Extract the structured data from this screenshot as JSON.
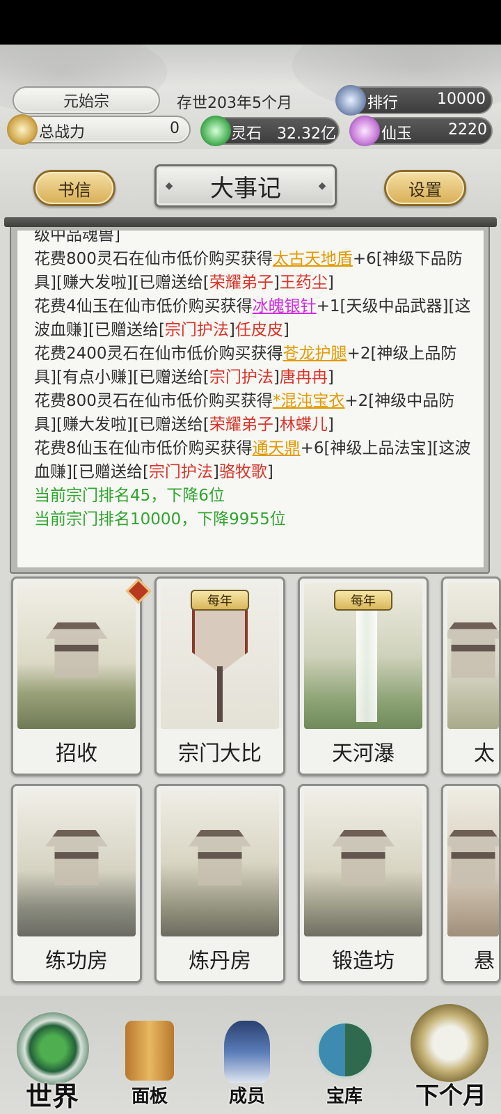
{
  "header": {
    "sect_name": "元始宗",
    "age": "存世203年5个月",
    "rank_label": "排行",
    "rank_value": "10000",
    "power_label": "总战力",
    "power_value": "0",
    "spirit_stone_label": "灵石",
    "spirit_stone_value": "32.32亿",
    "jade_label": "仙玉",
    "jade_value": "2220"
  },
  "tabs": {
    "left_button": "书信",
    "title": "大事记",
    "right_button": "设置"
  },
  "log": {
    "lines": [
      {
        "segments": [
          {
            "t": "级中品魂兽]",
            "c": ""
          }
        ]
      },
      {
        "segments": [
          {
            "t": "花费800灵石在仙市低价购买获得",
            "c": ""
          },
          {
            "t": "太古天地盾",
            "c": "gold"
          },
          {
            "t": "+6[神级下品防具][赚大发啦][已赠送给[",
            "c": ""
          },
          {
            "t": "荣耀弟子",
            "c": "red"
          },
          {
            "t": "]",
            "c": ""
          },
          {
            "t": "王药尘",
            "c": "red"
          },
          {
            "t": "]",
            "c": ""
          }
        ]
      },
      {
        "segments": [
          {
            "t": "花费4仙玉在仙市低价购买获得",
            "c": ""
          },
          {
            "t": "冰魄银针",
            "c": "purple"
          },
          {
            "t": "+1[天级中品武器][这波血赚][已赠送给[",
            "c": ""
          },
          {
            "t": "宗门护法",
            "c": "red"
          },
          {
            "t": "]",
            "c": ""
          },
          {
            "t": "任皮皮",
            "c": "red"
          },
          {
            "t": "]",
            "c": ""
          }
        ]
      },
      {
        "segments": [
          {
            "t": "花费2400灵石在仙市低价购买获得",
            "c": ""
          },
          {
            "t": "苍龙护腿",
            "c": "gold"
          },
          {
            "t": "+2[神级上品防具][有点小赚][已赠送给[",
            "c": ""
          },
          {
            "t": "宗门护法",
            "c": "red"
          },
          {
            "t": "]",
            "c": ""
          },
          {
            "t": "唐冉冉",
            "c": "red"
          },
          {
            "t": "]",
            "c": ""
          }
        ]
      },
      {
        "segments": [
          {
            "t": "花费800灵石在仙市低价购买获得",
            "c": ""
          },
          {
            "t": "*混沌宝衣",
            "c": "gold"
          },
          {
            "t": "+2[神级中品防具][赚大发啦][已赠送给[",
            "c": ""
          },
          {
            "t": "荣耀弟子",
            "c": "red"
          },
          {
            "t": "]",
            "c": ""
          },
          {
            "t": "林蝶儿",
            "c": "red"
          },
          {
            "t": "]",
            "c": ""
          }
        ]
      },
      {
        "segments": [
          {
            "t": "花费8仙玉在仙市低价购买获得",
            "c": ""
          },
          {
            "t": "通天鼎",
            "c": "gold"
          },
          {
            "t": "+6[神级上品法宝][这波血赚][已赠送给[",
            "c": ""
          },
          {
            "t": "宗门护法",
            "c": "red"
          },
          {
            "t": "]",
            "c": ""
          },
          {
            "t": "骆牧歌",
            "c": "red"
          },
          {
            "t": "]",
            "c": ""
          }
        ]
      },
      {
        "segments": [
          {
            "t": "当前宗门排名45，下降6位",
            "c": "green"
          }
        ]
      },
      {
        "segments": [
          {
            "t": "当前宗门排名10000，下降9955位",
            "c": "green"
          }
        ]
      }
    ]
  },
  "buildings": {
    "yearly_badge": "每年",
    "items": [
      {
        "label": "招收"
      },
      {
        "label": "宗门大比"
      },
      {
        "label": "天河瀑"
      },
      {
        "label": "太"
      },
      {
        "label": "练功房"
      },
      {
        "label": "炼丹房"
      },
      {
        "label": "锻造坊"
      },
      {
        "label": "悬"
      }
    ]
  },
  "nav": {
    "world": "世界",
    "panel": "面板",
    "members": "成员",
    "treasury": "宝库",
    "next_month": "下个月"
  },
  "colors": {
    "red_text": "#d8332a",
    "gold_text": "#e29a00",
    "purple_text": "#cc2ee0",
    "green_text": "#2fa52f",
    "gold_button": "#d7ae55"
  }
}
